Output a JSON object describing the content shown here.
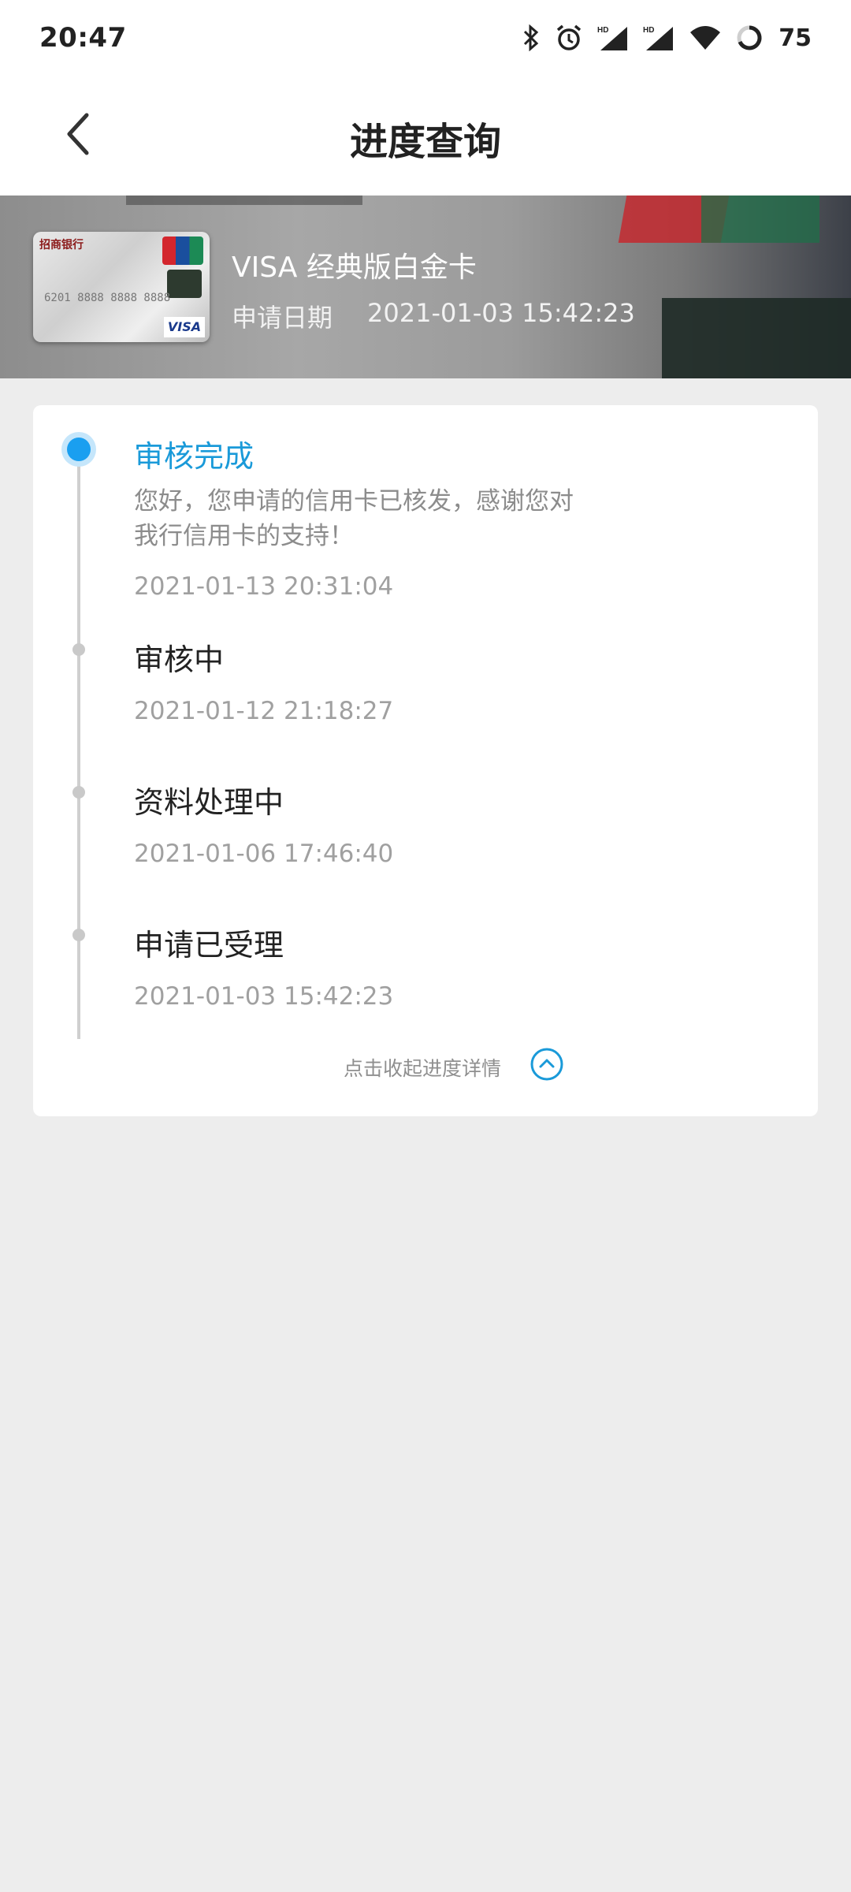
{
  "status_bar": {
    "time": "20:47",
    "battery": "75",
    "icons": [
      "bluetooth-icon",
      "alarm-icon",
      "hd-signal-icon",
      "hd-signal-icon",
      "wifi-icon",
      "battery-icon"
    ]
  },
  "nav": {
    "title": "进度查询",
    "back_icon": "chevron-left-icon"
  },
  "card": {
    "name": "VISA 经典版白金卡",
    "apply_label": "申请日期",
    "apply_date": "2021-01-03 15:42:23",
    "thumb_bank": "招商银行",
    "thumb_number": "6201 8888 8888 8888",
    "thumb_visa": "VISA"
  },
  "progress": {
    "steps": [
      {
        "title": "审核完成",
        "desc": "您好，您申请的信用卡已核发，感谢您对我行信用卡的支持！",
        "time": "2021-01-13 20:31:04",
        "active": true
      },
      {
        "title": "审核中",
        "time": "2021-01-12 21:18:27",
        "active": false
      },
      {
        "title": "资料处理中",
        "time": "2021-01-06 17:46:40",
        "active": false
      },
      {
        "title": "申请已受理",
        "time": "2021-01-03 15:42:23",
        "active": false
      }
    ],
    "collapse_label": "点击收起进度详情"
  },
  "colors": {
    "accent": "#1a9ad9",
    "active_dot": "#1a9ff0",
    "background": "#ededed"
  }
}
